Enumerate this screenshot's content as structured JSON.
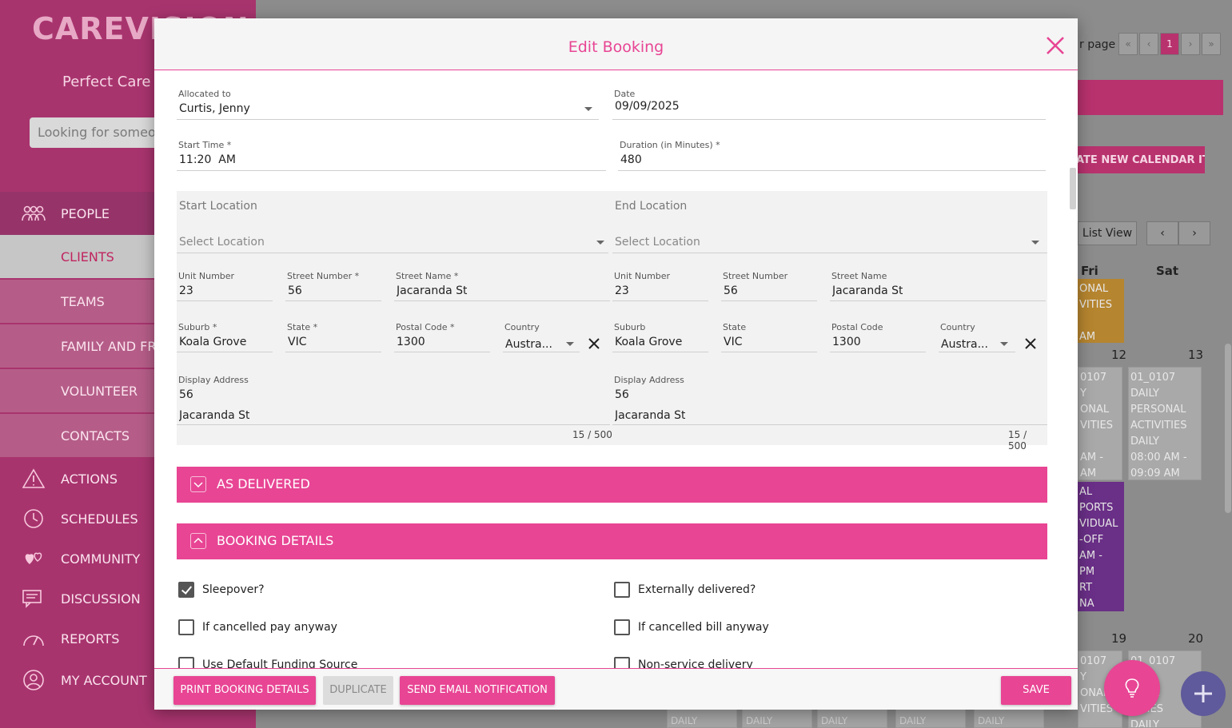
{
  "app": {
    "brand": "CAREVISION",
    "organisation": "Perfect Care C",
    "search_placeholder": "Looking for someon"
  },
  "sidebar": {
    "people_label": "PEOPLE",
    "sub_items": [
      "CLIENTS",
      "TEAMS",
      "FAMILY AND FR",
      "VOLUNTEER",
      "CONTACTS"
    ],
    "items": [
      "ACTIONS",
      "SCHEDULES",
      "COMMUNITY",
      "DISCUSSION",
      "REPORTS",
      "MY ACCOUNT"
    ]
  },
  "background": {
    "per_page_label": "r page",
    "pager": [
      "«",
      "‹",
      "1",
      "›",
      "»"
    ],
    "create_button": "ATE NEW CALENDAR ITEM",
    "list_view_label": "List View",
    "prev_label": "‹",
    "next_label": "›",
    "day_headers": [
      "Fri",
      "Sat"
    ],
    "dates": [
      "12",
      "13",
      "19",
      "20"
    ],
    "events": {
      "fri_top": "ONAL\nVITIES\n\nAM",
      "fri_mid": "0107\nY\nONAL\nVITIES\n\nAM -\nAM",
      "sat_mid": "01_0107\nDAILY\nPERSONAL\nACTIVITIES\nDAILY\n08:00 AM -\n09:09 AM",
      "fri_purple": "AL\nPORTS\nVIDUAL\n-OFF\nAM -\nPM\nRT\nNA",
      "fri_bottom": "0107\nY\nONAL\nVITIES",
      "sat_bottom": "01_0107\nY\nONAL\nVITIES\nDAILY"
    },
    "strip_label": "DAILY"
  },
  "modal": {
    "title": "Edit Booking",
    "allocated_to": {
      "label": "Allocated to",
      "value": "Curtis, Jenny"
    },
    "date": {
      "label": "Date",
      "value": "09/09/2025"
    },
    "start_time": {
      "label": "Start Time *",
      "value": "11:20  AM"
    },
    "duration": {
      "label": "Duration (in Minutes) *",
      "value": "480"
    },
    "start_location": {
      "title": "Start Location",
      "select_placeholder": "Select Location",
      "unit_number": {
        "label": "Unit Number",
        "value": "23"
      },
      "street_number": {
        "label": "Street Number *",
        "value": "56"
      },
      "street_name": {
        "label": "Street Name *",
        "value": "Jacaranda St"
      },
      "suburb": {
        "label": "Suburb *",
        "value": "Koala Grove"
      },
      "state": {
        "label": "State *",
        "value": "VIC"
      },
      "postal_code": {
        "label": "Postal Code *",
        "value": "1300"
      },
      "country": {
        "label": "Country",
        "value": "Austra..."
      },
      "display_address": {
        "label": "Display Address",
        "line1": "56",
        "line2": "Jacaranda St"
      },
      "counter": "15 / 500"
    },
    "end_location": {
      "title": "End Location",
      "select_placeholder": "Select Location",
      "unit_number": {
        "label": "Unit Number",
        "value": "23"
      },
      "street_number": {
        "label": "Street Number",
        "value": "56"
      },
      "street_name": {
        "label": "Street Name",
        "value": "Jacaranda St"
      },
      "suburb": {
        "label": "Suburb",
        "value": "Koala Grove"
      },
      "state": {
        "label": "State",
        "value": "VIC"
      },
      "postal_code": {
        "label": "Postal Code",
        "value": "1300"
      },
      "country": {
        "label": "Country",
        "value": "Austra..."
      },
      "display_address": {
        "label": "Display Address",
        "line1": "56",
        "line2": "Jacaranda St"
      },
      "counter": "15 / 500"
    },
    "sections": {
      "as_delivered": "AS DELIVERED",
      "booking_details": "BOOKING DETAILS"
    },
    "checkboxes": {
      "sleepover": {
        "label": "Sleepover?",
        "checked": true
      },
      "externally_delivered": {
        "label": "Externally delivered?",
        "checked": false
      },
      "cancelled_pay": {
        "label": "If cancelled pay anyway",
        "checked": false
      },
      "cancelled_bill": {
        "label": "If cancelled bill anyway",
        "checked": false
      },
      "default_funding": {
        "label": "Use Default Funding Source",
        "checked": false
      },
      "non_service": {
        "label": "Non-service delivery",
        "checked": false
      }
    },
    "footer": {
      "print": "PRINT BOOKING DETAILS",
      "duplicate": "DUPLICATE",
      "send_email": "SEND EMAIL NOTIFICATION",
      "save": "SAVE"
    }
  },
  "colors": {
    "accent": "#e84594",
    "sidebar": "#a8346e"
  },
  "icons": {
    "close": "close-icon",
    "clear": "clear-icon",
    "lightbulb": "lightbulb-icon",
    "add": "add-icon"
  }
}
